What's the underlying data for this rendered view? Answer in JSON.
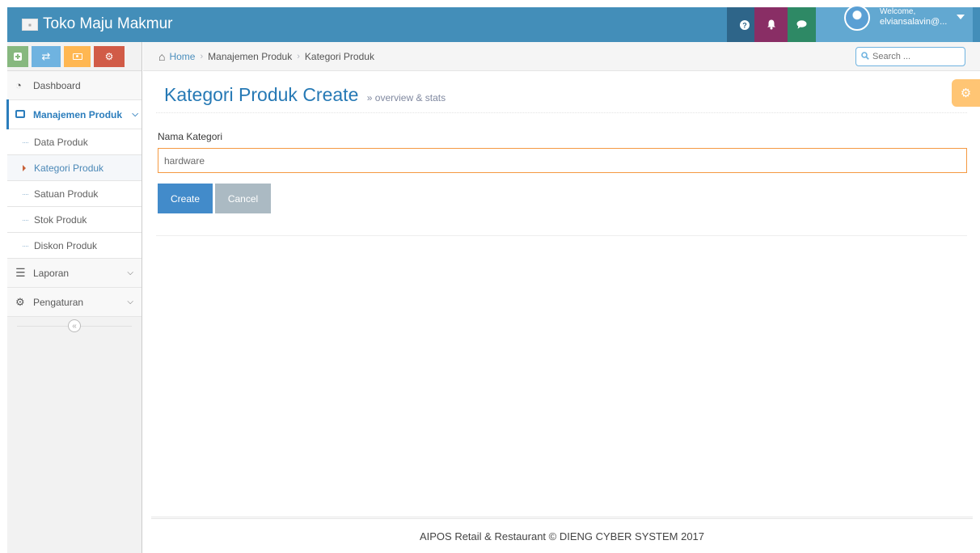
{
  "navbar": {
    "brand": "Toko Maju Makmur",
    "welcome": "Welcome,",
    "username": "elviansalavin@...",
    "colors": {
      "bar": "#438eb9",
      "help": "#2e6589",
      "bell": "#892e65",
      "msg": "#2e8965",
      "user": "#62a8d1"
    }
  },
  "shortcuts": [
    {
      "icon": "plus-square-icon",
      "color": "#87b87f"
    },
    {
      "icon": "exchange-icon",
      "color": "#6fb3e0"
    },
    {
      "icon": "money-icon",
      "color": "#ffb752"
    },
    {
      "icon": "cogs-icon",
      "color": "#d15b47"
    }
  ],
  "sidebar": {
    "dashboard": "Dashboard",
    "manajemen": "Manajemen Produk",
    "submenu": [
      "Data Produk",
      "Kategori Produk",
      "Satuan Produk",
      "Stok Produk",
      "Diskon Produk"
    ],
    "laporan": "Laporan",
    "pengaturan": "Pengaturan"
  },
  "breadcrumbs": {
    "home": "Home",
    "level1": "Manajemen Produk",
    "level2": "Kategori Produk"
  },
  "search": {
    "placeholder": "Search ..."
  },
  "page": {
    "title": "Kategori Produk Create",
    "subtitle": "overview & stats"
  },
  "form": {
    "label": "Nama Kategori",
    "value": "hardware",
    "create_label": "Create",
    "cancel_label": "Cancel"
  },
  "footer": {
    "text": "AIPOS Retail & Restaurant © DIENG CYBER SYSTEM 2017"
  }
}
